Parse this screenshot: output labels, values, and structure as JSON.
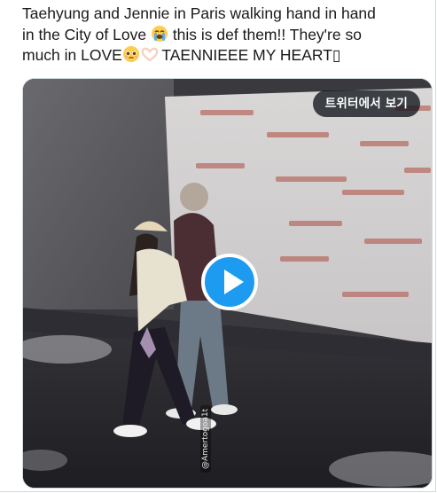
{
  "tweet": {
    "line1": "Taehyung and Jennie in Paris walking hand in hand",
    "line2a": "in the City of Love ",
    "line2b": " this is def them!! They're so",
    "line3a": "much in LOVE",
    "line3b": " TAENNIEEE MY HEART▯",
    "emoji1": "loudly-crying-face-emoji",
    "emoji2": "pleading-face-emoji",
    "emoji3": "heart-hands-emoji"
  },
  "media": {
    "view_on_twitter_label": "트위터에서 보기",
    "play_icon": "play-icon",
    "watermark": "@Amertogoa1t",
    "accent_color": "#1d9bf0"
  }
}
